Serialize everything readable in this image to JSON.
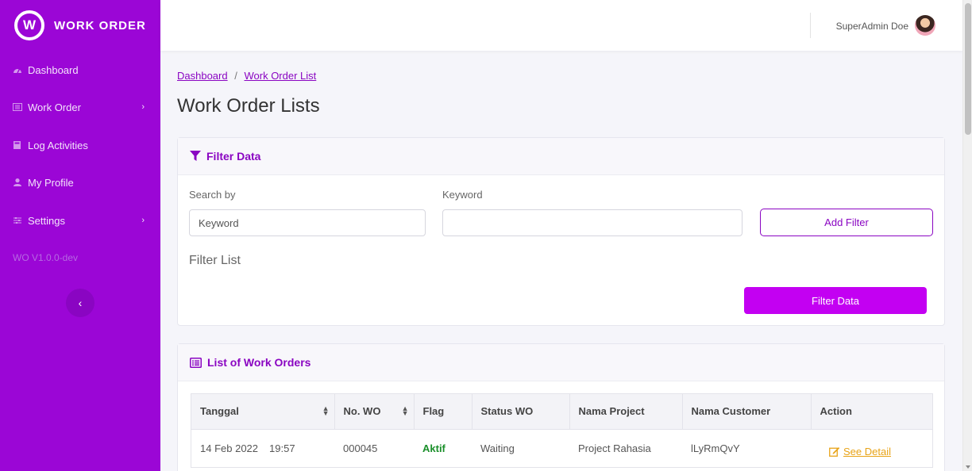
{
  "brand": {
    "logo_letter": "W",
    "name": "WORK ORDER"
  },
  "sidebar": {
    "items": [
      {
        "label": "Dashboard",
        "icon": "tachometer-icon",
        "has_chevron": false
      },
      {
        "label": "Work Order",
        "icon": "list-icon",
        "has_chevron": true
      },
      {
        "label": "Log Activities",
        "icon": "book-icon",
        "has_chevron": false
      },
      {
        "label": "My Profile",
        "icon": "user-icon",
        "has_chevron": false
      },
      {
        "label": "Settings",
        "icon": "settings-icon",
        "has_chevron": true
      }
    ],
    "version": "WO V1.0.0-dev",
    "collapse_icon": "chevron-left-icon"
  },
  "topbar": {
    "user_name": "SuperAdmin Doe"
  },
  "breadcrumb": {
    "items": [
      "Dashboard",
      "Work Order List"
    ],
    "separator": "/"
  },
  "page": {
    "title": "Work Order Lists"
  },
  "filter": {
    "title": "Filter Data",
    "search_by_label": "Search by",
    "search_by_value": "Keyword",
    "keyword_label": "Keyword",
    "keyword_value": "",
    "add_filter_label": "Add Filter",
    "filter_list_title": "Filter List",
    "filter_button_label": "Filter Data"
  },
  "work_orders": {
    "title": "List of Work Orders",
    "columns": [
      "Tanggal",
      "No. WO",
      "Flag",
      "Status WO",
      "Nama Project",
      "Nama Customer",
      "Action"
    ],
    "rows": [
      {
        "date": "14 Feb 2022",
        "time": "19:57",
        "no_wo": "000045",
        "flag": "Aktif",
        "status": "Waiting",
        "project": "Project Rahasia",
        "customer": "lLyRmQvY",
        "action": "See Detail"
      }
    ]
  },
  "colors": {
    "sidebar": "#9b06d6",
    "accent": "#8a05c2",
    "primary_button": "#c300f2",
    "flag_active": "#1a8f2a",
    "link_action": "#e8a317"
  }
}
